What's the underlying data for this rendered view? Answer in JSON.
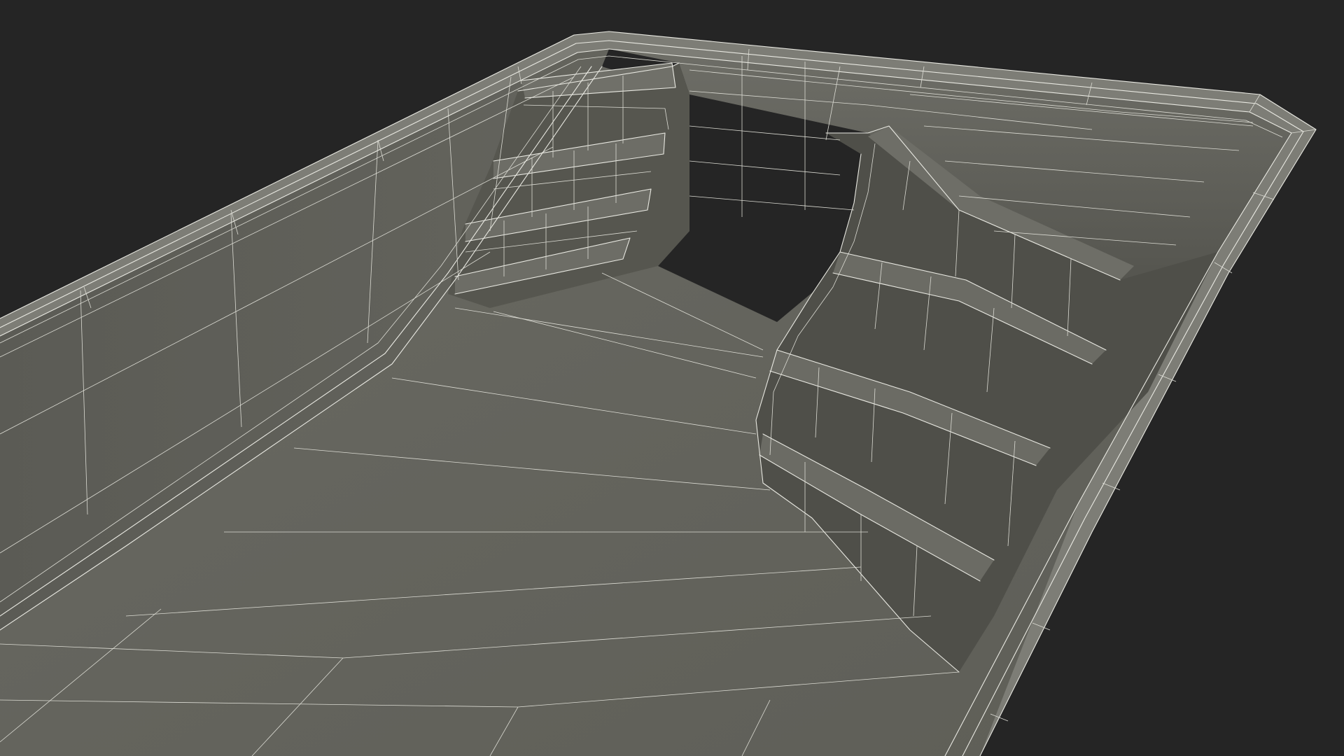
{
  "scene": {
    "subject": "pool-shell-wireframe",
    "render_mode": "wireframe-on-shaded",
    "colors": {
      "background": "#252525",
      "wire": "#e9e9e2",
      "floor": "#65655e",
      "wall": "#585852",
      "rim": "#808079",
      "step_riser": "#4e4e48",
      "step_tread": "#6c6c65"
    }
  }
}
